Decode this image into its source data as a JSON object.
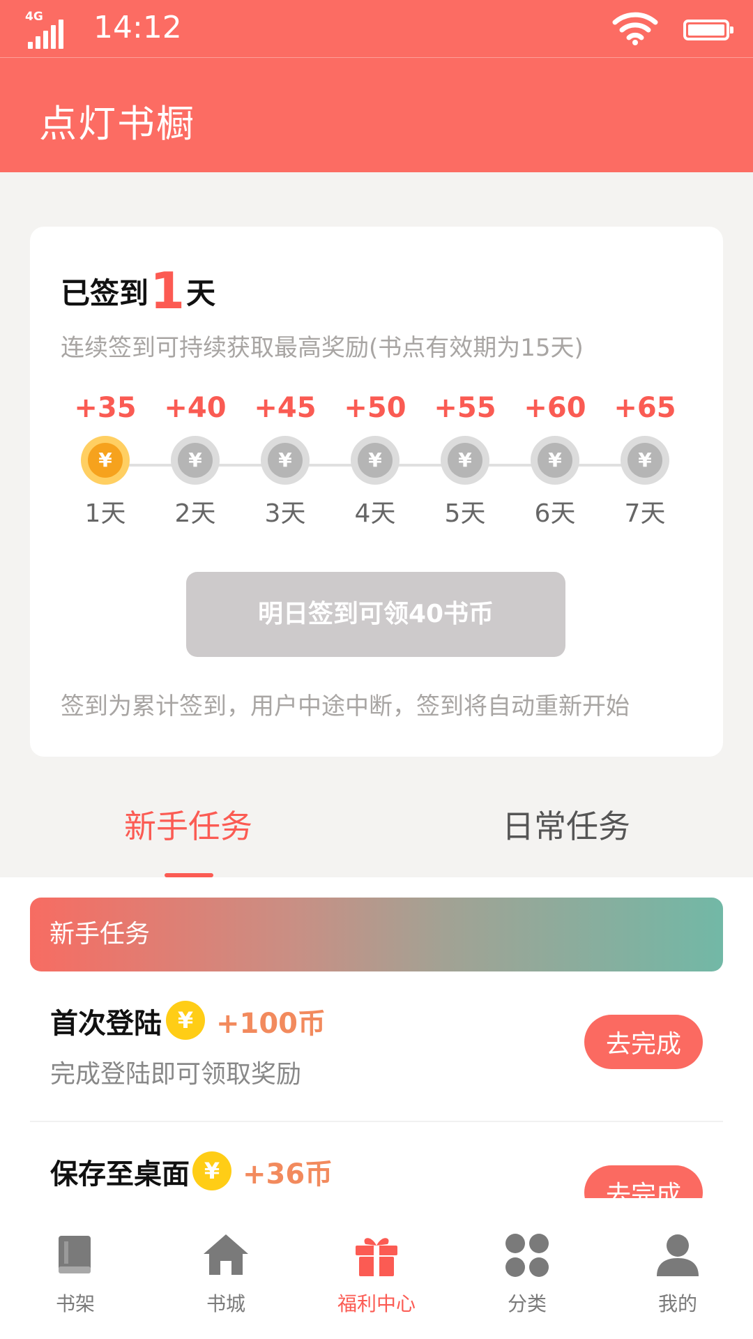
{
  "status_bar": {
    "network": "4G",
    "time": "14:12"
  },
  "header": {
    "title": "点灯书橱"
  },
  "signin": {
    "prefix": "已签到",
    "days": "1",
    "suffix": "天",
    "tip": "连续签到可持续获取最高奖励(书点有效期为15天)",
    "active_day": 1,
    "days_list": [
      {
        "reward": "+35",
        "label": "1天"
      },
      {
        "reward": "+40",
        "label": "2天"
      },
      {
        "reward": "+45",
        "label": "3天"
      },
      {
        "reward": "+50",
        "label": "4天"
      },
      {
        "reward": "+55",
        "label": "5天"
      },
      {
        "reward": "+60",
        "label": "6天"
      },
      {
        "reward": "+65",
        "label": "7天"
      }
    ],
    "coin_symbol": "¥",
    "button_label": "明日签到可领40书币",
    "rule": "签到为累计签到，用户中途中断，签到将自动重新开始"
  },
  "tabs": [
    {
      "label": "新手任务",
      "active": true
    },
    {
      "label": "日常任务",
      "active": false
    }
  ],
  "tasks": {
    "banner": "新手任务",
    "items": [
      {
        "name": "首次登陆",
        "reward": "+100币",
        "desc": "完成登陆即可领取奖励",
        "button": "去完成"
      },
      {
        "name": "保存至桌面",
        "reward": "+36币",
        "desc": "",
        "button": "去完成"
      }
    ]
  },
  "bottom_nav": [
    {
      "label": "书架",
      "icon": "book-icon",
      "active": false
    },
    {
      "label": "书城",
      "icon": "home-icon",
      "active": false
    },
    {
      "label": "福利中心",
      "icon": "gift-icon",
      "active": true
    },
    {
      "label": "分类",
      "icon": "grid-icon",
      "active": false
    },
    {
      "label": "我的",
      "icon": "user-icon",
      "active": false
    }
  ],
  "colors": {
    "brand": "#fc6c63",
    "accent": "#fb5b53",
    "coin_active": "#f6a21d",
    "coin_inactive": "#b5b5b5",
    "task_coin": "#ffcd16",
    "banner_end": "#72b8a6"
  }
}
